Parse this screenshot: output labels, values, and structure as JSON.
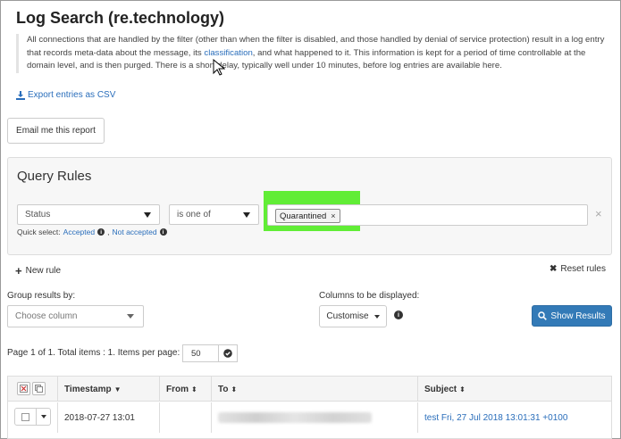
{
  "page": {
    "title": "Log Search (re.technology)",
    "description_before": "All connections that are handled by the filter (other than when the filter is disabled, and those handled by denial of service protection) result in a log entry that records meta-data about the message, its ",
    "description_link": "classification",
    "description_after": ", and what happened to it. This information is kept for a period of time controllable at the domain level, and is then purged. There is a short delay, typically well under 10 minutes, before log entries are available here."
  },
  "actions": {
    "export_label": "Export entries as CSV",
    "email_label": "Email me this report"
  },
  "query": {
    "title": "Query Rules",
    "field_value": "Status",
    "operator_value": "is one of",
    "tags": [
      "Quarantined"
    ],
    "tag_remove": "×",
    "rule_remove": "×",
    "quick_select_label": "Quick select:",
    "quick_accepted": "Accepted",
    "quick_not_accepted": "Not accepted",
    "highlight_color": "#46eb14"
  },
  "rules": {
    "new_rule": "New rule",
    "reset_rules": "Reset rules"
  },
  "controls": {
    "group_label": "Group results by:",
    "group_placeholder": "Choose column",
    "columns_label": "Columns to be displayed:",
    "customise_label": "Customise",
    "show_results_label": "Show Results",
    "accent_color": "#337ab7"
  },
  "pagination": {
    "info": "Page 1 of 1. Total items : 1. Items per page:",
    "per_page": "50"
  },
  "table": {
    "columns": [
      "Timestamp",
      "From",
      "To",
      "Subject"
    ],
    "rows": [
      {
        "timestamp": "2018-07-27 13:01",
        "from": "",
        "subject": "test Fri, 27 Jul 2018 13:01:31 +0100"
      }
    ]
  }
}
